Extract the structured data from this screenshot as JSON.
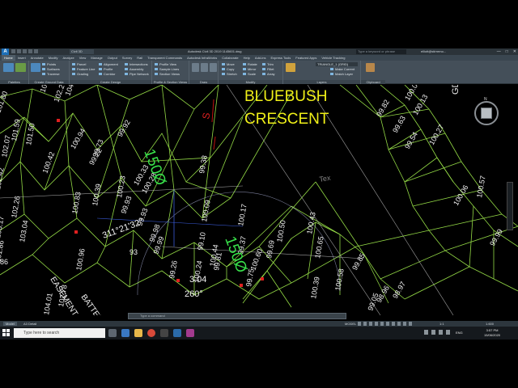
{
  "titlebar": {
    "app_letter": "A",
    "file_tab": "Civil 3D",
    "title": "Autodesk Civil 3D 2019    1145601.dwg",
    "search_placeholder": "Type a keyword or phrase",
    "user": "elliott@stirremo...",
    "minimize": "—",
    "maximize": "□",
    "close": "✕"
  },
  "ribbon_tabs": [
    "Home",
    "Insert",
    "Annotate",
    "Modify",
    "Analyze",
    "View",
    "Manage",
    "Output",
    "Survey",
    "Rail",
    "Transparent Commands",
    "Autodesk InfraWorks",
    "Collaborate",
    "Help",
    "Add-ins",
    "Express Tools",
    "Featured Apps",
    "Vehicle Tracking"
  ],
  "ribbon": {
    "palettes_label": "Palettes",
    "ground_data": {
      "title": "Create Ground Data",
      "items": [
        "Points",
        "Surfaces",
        "Traverse"
      ]
    },
    "design": {
      "title": "Create Design",
      "items": [
        "Parcel",
        "Feature Line",
        "Grading",
        "Alignment",
        "Profile",
        "Corridor",
        "Intersections",
        "Assembly",
        "Pipe Network"
      ]
    },
    "profile": {
      "title": "Profile & Section Views",
      "items": [
        "Profile View",
        "Sample Lines",
        "Section Views"
      ]
    },
    "draw_title": "Draw",
    "modify": {
      "title": "Modify",
      "items": [
        "Move",
        "Copy",
        "Stretch",
        "Rotate",
        "Mirror",
        "Scale",
        "Trim",
        "Fillet",
        "Array"
      ]
    },
    "layers": {
      "title": "Layers",
      "current_layer": "TRIANGLE_1 (GRID)",
      "items": [
        "Make Current",
        "Match Layer"
      ],
      "properties_label": "Layer Properties"
    },
    "clipboard": {
      "title": "Clipboard",
      "paste_label": "Paste"
    }
  },
  "drawing": {
    "street_line1": "BLUEBUSH",
    "street_line2": "CRESCENT",
    "direction_label": "GDA",
    "compass_n": "N",
    "compass_s": "S",
    "frame_label": "Tex",
    "green_labels": [
      "150Ø",
      "150Ø"
    ],
    "spot_levels": [
      {
        "text": "104.18"
      },
      {
        "text": "102.26"
      },
      {
        "text": "101.80"
      },
      {
        "text": "104.60"
      },
      {
        "text": "101.50"
      },
      {
        "text": "101.59"
      },
      {
        "text": "102.07"
      },
      {
        "text": "100.94"
      },
      {
        "text": "100.42"
      },
      {
        "text": "99.92"
      },
      {
        "text": "99.22"
      },
      {
        "text": "100.28"
      },
      {
        "text": "102.42"
      },
      {
        "text": "102.26"
      },
      {
        "text": "103.04"
      },
      {
        "text": "100.83"
      },
      {
        "text": "100.39"
      },
      {
        "text": "100.23"
      },
      {
        "text": "99.93"
      },
      {
        "text": "99.38"
      },
      {
        "text": "100.33"
      },
      {
        "text": "99.98"
      },
      {
        "text": "99.99"
      },
      {
        "text": "100.09"
      },
      {
        "text": "100.17"
      },
      {
        "text": "100.50"
      },
      {
        "text": "100.43"
      },
      {
        "text": "100.44"
      },
      {
        "text": "99.82"
      },
      {
        "text": "100.04"
      },
      {
        "text": "100.13"
      },
      {
        "text": "99.54"
      },
      {
        "text": "100.27"
      },
      {
        "text": "100.57"
      },
      {
        "text": "100.06"
      },
      {
        "text": "98.96"
      },
      {
        "text": "98.97"
      },
      {
        "text": "99.75"
      },
      {
        "text": "101.86"
      },
      {
        "text": "104.01"
      },
      {
        "text": "100.39"
      },
      {
        "text": "99.37"
      },
      {
        "text": "99.10"
      },
      {
        "text": "103.17"
      },
      {
        "text": "100.24"
      },
      {
        "text": "99.81"
      },
      {
        "text": "100.65"
      },
      {
        "text": "100.58"
      },
      {
        "text": "99.69"
      },
      {
        "text": "99.26"
      },
      {
        "text": "100.60"
      },
      {
        "text": "99.93"
      },
      {
        "text": "102.78"
      },
      {
        "text": "100.96"
      },
      {
        "text": "99.73"
      },
      {
        "text": "99.05"
      },
      {
        "text": "99.63"
      },
      {
        "text": "99.99"
      },
      {
        "text": "99.85"
      }
    ],
    "bearing": "311°21'32\"",
    "angle": "260°",
    "distance": "3.04",
    "easement_line1": "EASEMENT",
    "easement_line2": "BATTERS",
    "value_93": "93",
    "value_86": "86"
  },
  "command_line": {
    "placeholder": "Type a command"
  },
  "status": {
    "layout_tabs": [
      "Model",
      "A3 Detail"
    ],
    "model_label": "MODEL",
    "scale": "1:1",
    "value": "1.600"
  },
  "taskbar": {
    "search_placeholder": "Type here to search",
    "lang": "ENG",
    "time": "3:57 PM",
    "date": "15/06/2020"
  }
}
